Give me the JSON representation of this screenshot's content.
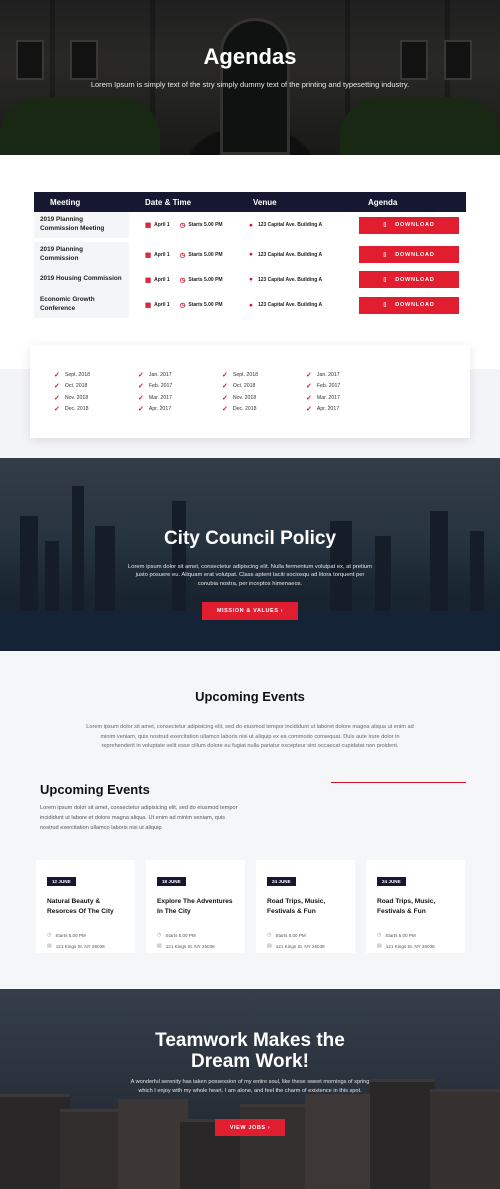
{
  "hero": {
    "title": "Agendas",
    "subtitle": "Lorem Ipsum is simply text of the stry simply dummy text of the printing and typesetting industry."
  },
  "agenda_table": {
    "headers": [
      "Meeting",
      "Date & Time",
      "Venue",
      "Agenda"
    ],
    "rows": [
      {
        "meeting": "2019 Planning Commission Meeting",
        "date": "April 1",
        "time": "Starts 5.00 PM",
        "venue": "123 Capital Ave. Building A",
        "action": "DOWNLOAD"
      },
      {
        "meeting": "2019 Planning Commission",
        "date": "April 1",
        "time": "Starts 5.00 PM",
        "venue": "123 Capital Ave. Building A",
        "action": "DOWNLOAD"
      },
      {
        "meeting": "2019 Housing Commission",
        "date": "April 1",
        "time": "Starts 5.00 PM",
        "venue": "123 Capital Ave. Building A",
        "action": "DOWNLOAD"
      },
      {
        "meeting": "Economic Growth Conference",
        "date": "April 1",
        "time": "Starts 5.00 PM",
        "venue": "123 Capital Ave. Building A",
        "action": "DOWNLOAD"
      }
    ]
  },
  "archive": {
    "columns": [
      [
        "Sept. 2018",
        "Oct. 2018",
        "Nov. 2018",
        "Dec. 2018"
      ],
      [
        "Jan. 2017",
        "Feb. 2017",
        "Mar. 2017",
        "Apr. 2017"
      ],
      [
        "Sept. 2018",
        "Oct. 2018",
        "Nov. 2018",
        "Dec. 2018"
      ],
      [
        "Jan. 2017",
        "Feb. 2017",
        "Mar. 2017",
        "Apr. 2017"
      ]
    ]
  },
  "policy": {
    "title": "City Council Policy",
    "text": "Lorem ipsum dolor sit amet, consectetur adipiscing elit. Nulla fermentum volutpat ex, at pretium justo posuere eu. Aliquam erat volutpat. Class aptent taciti sociosqu ad litora torquent per conubia nostra, per inceptos himenaeos.",
    "button": "MISSION & VALUES ›"
  },
  "events": {
    "title": "Upcoming Events",
    "intro": "Lorem ipsum dolor sit amet, consectetur adipisicing elit, sed do eiusmod tempor incididunt ut laboret dolore magna aliqua ut enim ad minim veniam, quis nostrud exercitation ullamco laboris nisi ut aliquip ex ea commodo consequat. Duis aute irure dolor in reprehenderit in voluptate velit esse cillum dolore eu fugiat nulla pariatur excepteur sint occaecat cupidatat non proident.",
    "subtitle": "Upcoming Events",
    "subtext": "Lorem ipsum dolor sit amet, consectetur adipisicing elit, sed do eiusmod tempor incididunt ut labore et dolore magna aliqua. Ut enim ad minim veniam, quis nostrud exercitation ullamco laboris nisi ut aliquip",
    "cards": [
      {
        "badge": "12 JUNE",
        "title": "Natural Beauty & Resorces Of The City",
        "time": "Starts 5.00 PM",
        "address": "121 Kings St. NY 26038"
      },
      {
        "badge": "18 JUNE",
        "title": "Explore The Adventures In The City",
        "time": "Starts 5.00 PM",
        "address": "121 Kings St. NY 26038"
      },
      {
        "badge": "24 JUNE",
        "title": "Road Trips, Music, Festivals & Fun",
        "time": "Starts 5.00 PM",
        "address": "121 Kings St. NY 26038"
      },
      {
        "badge": "24 JUNE",
        "title": "Road Trips, Music, Festivals & Fun",
        "time": "Starts 5.00 PM",
        "address": "121 Kings St. NY 26038"
      }
    ]
  },
  "team": {
    "title_line1": "Teamwork Makes the",
    "title_line2": "Dream Work!",
    "text": "A wonderful serenity has taken possession of my entire soul, like these sweet mornings of spring which I enjoy with my whole heart. I am alone, and feel the charm of existence in this spot.",
    "button": "VIEW JOBS ›"
  },
  "colors": {
    "accent": "#e11d30",
    "navy": "#161831"
  }
}
